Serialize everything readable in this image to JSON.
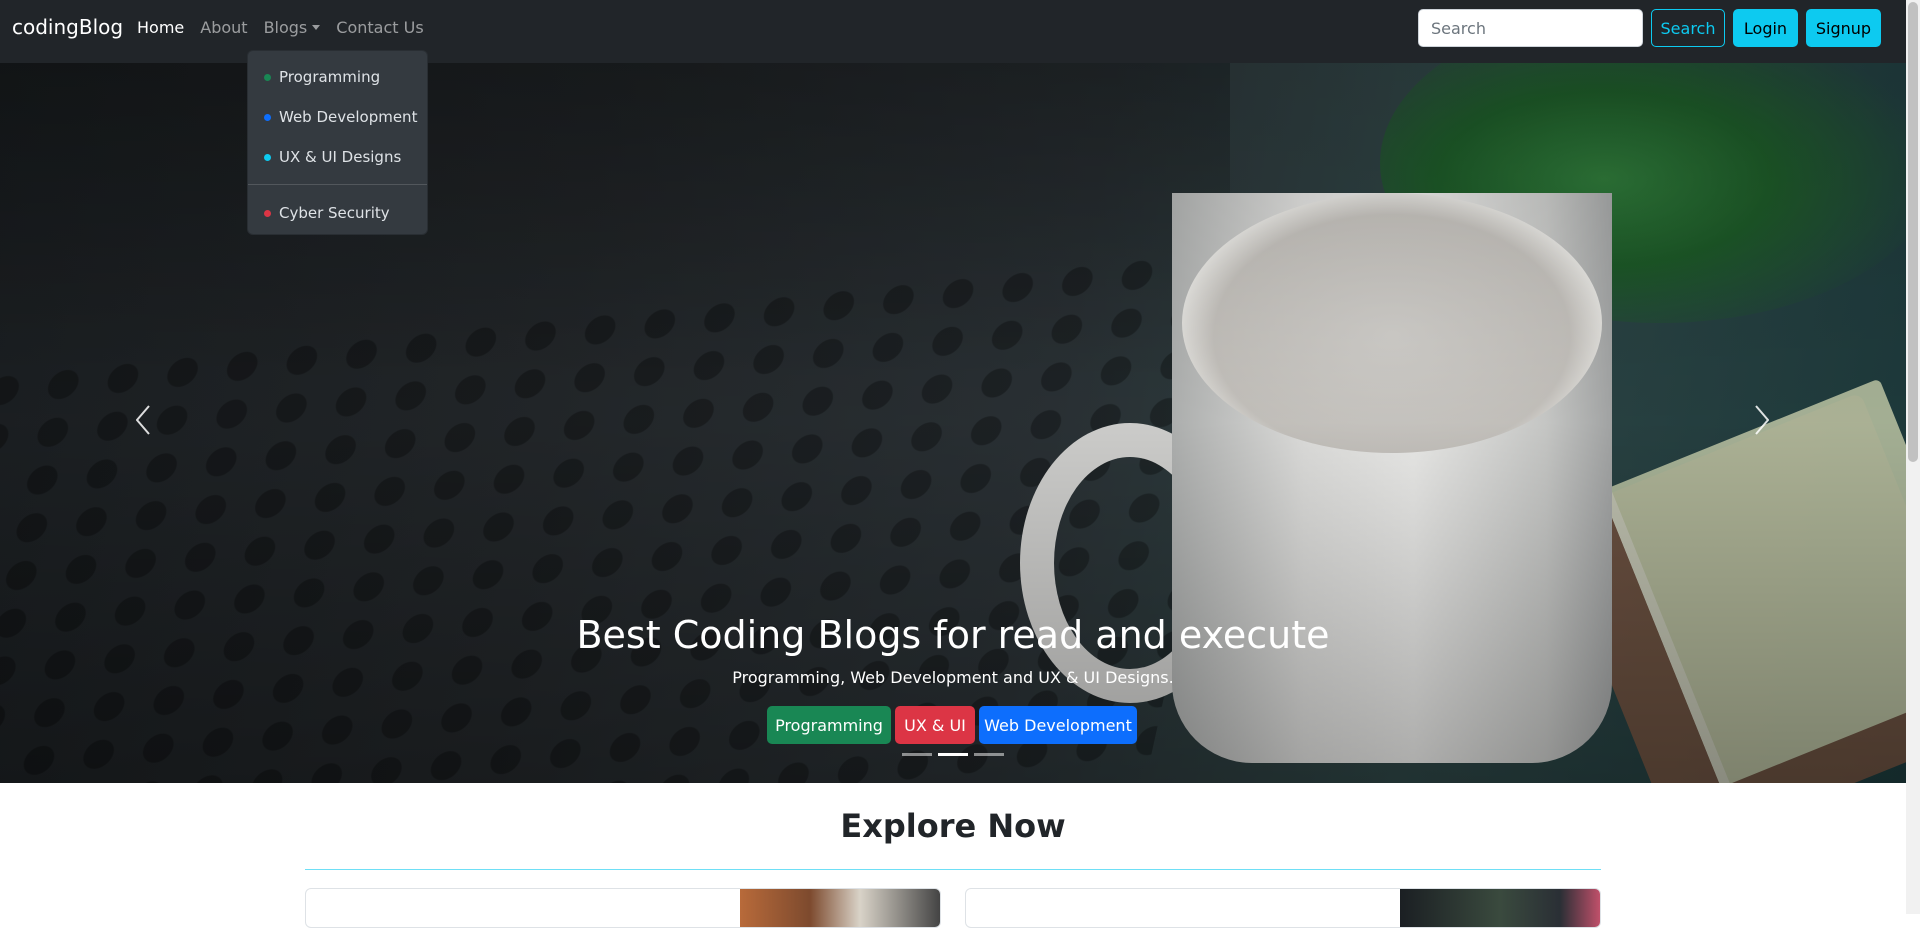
{
  "navbar": {
    "brand": "codingBlog",
    "links": [
      "Home",
      "About",
      "Blogs",
      "Contact Us"
    ],
    "search_placeholder": "Search",
    "search_button": "Search",
    "login_button": "Login",
    "signup_button": "Signup"
  },
  "dropdown": {
    "items": [
      {
        "label": "Programming",
        "color": "#198754"
      },
      {
        "label": "Web Development",
        "color": "#0d6efd"
      },
      {
        "label": "UX & UI Designs",
        "color": "#0dcaf0"
      },
      {
        "label": "Cyber Security",
        "color": "#dc3545"
      }
    ]
  },
  "carousel": {
    "title": "Best Coding Blogs for read and execute",
    "subtitle": "Programming, Web Development and UX & UI Designs.",
    "buttons": [
      {
        "label": "Programming",
        "color": "#198754"
      },
      {
        "label": "UX & UI",
        "color": "#dc3545"
      },
      {
        "label": "Web Development",
        "color": "#0d6efd"
      }
    ],
    "active_slide": 2,
    "slide_count": 3
  },
  "explore": {
    "title": "Explore Now"
  },
  "colors": {
    "navbar_bg": "#212529",
    "accent": "#0dcaf0"
  }
}
